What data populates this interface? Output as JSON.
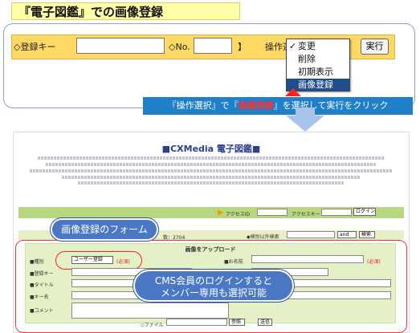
{
  "banner": {
    "title": "『電子図鑑』での画像登録"
  },
  "form": {
    "register_key_label": "◇登録キー",
    "no_label": "◇No.",
    "bracket": "】",
    "operation_label": "操作選択",
    "exec_button": "実行",
    "dropdown": {
      "options": [
        {
          "label": "変更",
          "checked": true
        },
        {
          "label": "削除",
          "checked": false
        },
        {
          "label": "初期表示",
          "checked": false
        },
        {
          "label": "画像登録",
          "checked": false,
          "highlighted": true
        }
      ]
    }
  },
  "caption": {
    "pre": "『操作選択』で『",
    "highlight": "画像登録",
    "post": "』を選択して実行をクリック"
  },
  "inner_screen": {
    "title": "■CXMedia 電子図鑑■",
    "count_text": "数：2704",
    "search_row_label": "◆検別以外検索",
    "and_label": "and",
    "search_button": "検索",
    "access_id_label": "アクセスID",
    "access_key_label": "アクセスキー",
    "login_button": "ログイン",
    "upload_title": "画像をアップロード",
    "fields": {
      "category_label": "■種別",
      "category_value": "ユーザー登録",
      "required": "(必須)",
      "register_key_label": "■登録キー",
      "title_label": "■タイトル",
      "keyword_label": "■キー名",
      "comment_label": "■コメント",
      "name_label": "■お名前",
      "required2": "(必須)",
      "file_label": "◇ファイル",
      "browse_button": "参照",
      "submit_button": "送信"
    }
  },
  "bubbles": {
    "form_bubble": "画像登録のフォーム",
    "cms_bubble_line1": "CMS会員のログインすると",
    "cms_bubble_line2": "メンバー専用も選択可能"
  },
  "colors": {
    "banner_bg": "#ffffa8",
    "strip_bg": "#ffd966",
    "highlight": "#1f4e8c",
    "caption_bg": "#1f7fc8",
    "bubble_bg": "#4a78c4",
    "accent_red": "#ff3030"
  }
}
